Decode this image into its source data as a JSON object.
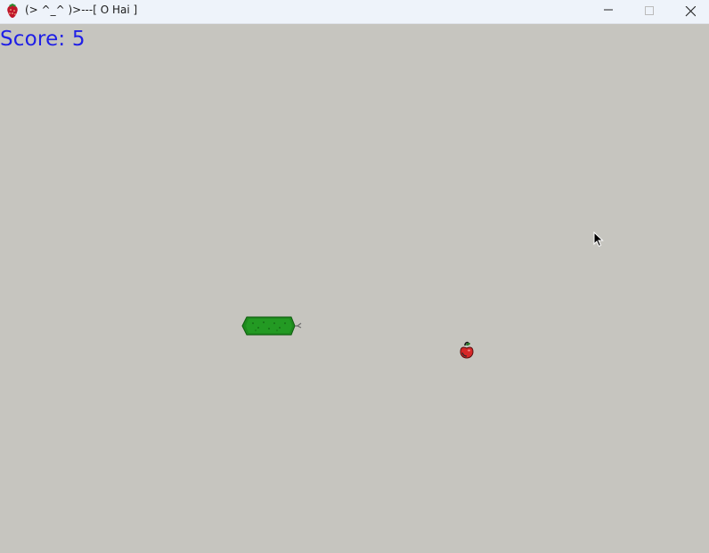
{
  "window": {
    "title": "(> ^_^ )>---[ O Hai ]",
    "icon": "strawberry-icon",
    "controls": [
      "minimize-icon",
      "maximize-icon",
      "close-icon"
    ]
  },
  "game": {
    "score_text": "Score: 5",
    "score": 5,
    "colors": {
      "background": "#c6c5bf",
      "score": "#1f1fe6",
      "snake": "#1e8a1e",
      "food": "#d62828"
    },
    "sprites": [
      "snake",
      "apple-food",
      "mouse-cursor"
    ]
  }
}
